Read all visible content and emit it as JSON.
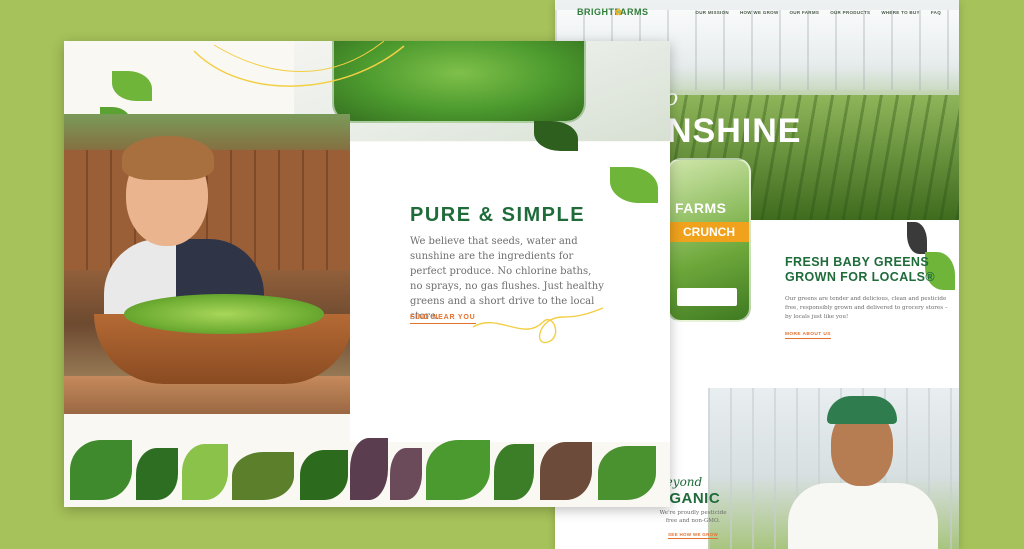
{
  "colors": {
    "background": "#a6c25a",
    "brand_green": "#1f6b3a",
    "accent_orange": "#e3712e",
    "logo_yellow": "#e6b320"
  },
  "right_page": {
    "logo": {
      "part1": "BRIGHT",
      "icon": "sun-leaf-icon",
      "part2": "FARMS"
    },
    "nav": [
      "OUR MISSION",
      "HOW WE GROW",
      "OUR FARMS",
      "OUR PRODUCTS",
      "WHERE TO BUY",
      "FAQ"
    ],
    "hero_script": "o",
    "hero_title": "NSHINE",
    "package": {
      "brand": "FARMS",
      "band": "CRUNCH"
    },
    "fresh": {
      "title": "FRESH BABY GREENS GROWN FOR LOCALS®",
      "body": "Our greens are tender and delicious, clean and pesticide free, responsibly grown and delivered to grocery stores – by locals just like you!",
      "link": "MORE ABOUT US"
    },
    "organic": {
      "script": "beyond",
      "title": "RGANIC",
      "body": "We're proudly pesticide free and non-GMO.",
      "link": "SEE HOW WE GROW"
    }
  },
  "left_page": {
    "title": "PURE & SIMPLE",
    "body": "We believe that seeds, water and sunshine are the ingredients for perfect produce. No chlorine baths, no sprays, no gas flushes. Just healthy greens and a short drive to the local store.",
    "link": "FIND NEAR YOU"
  }
}
